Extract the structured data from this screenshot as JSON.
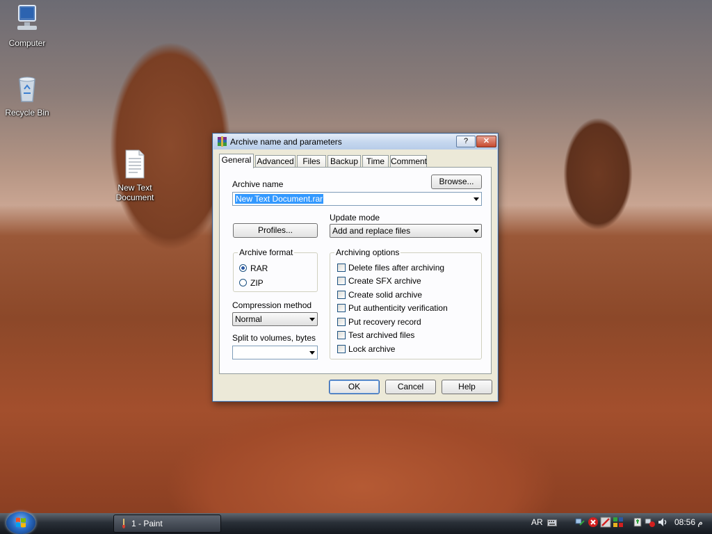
{
  "desktop": {
    "icons": [
      {
        "label": "Computer"
      },
      {
        "label": "Recycle Bin"
      },
      {
        "label_line1": "New Text",
        "label_line2": "Document"
      }
    ]
  },
  "dialog": {
    "title": "Archive name and parameters",
    "help_glyph": "?",
    "close_glyph": "✕",
    "tabs": [
      "General",
      "Advanced",
      "Files",
      "Backup",
      "Time",
      "Comment"
    ],
    "active_tab": "General",
    "archive_name_label": "Archive name",
    "browse_label": "Browse...",
    "archive_name_value": "New Text Document.rar",
    "profiles_label": "Profiles...",
    "update_mode_label": "Update mode",
    "update_mode_value": "Add and replace files",
    "archive_format": {
      "title": "Archive format",
      "options": [
        "RAR",
        "ZIP"
      ],
      "selected": "RAR"
    },
    "compression_label": "Compression method",
    "compression_value": "Normal",
    "split_label": "Split to volumes, bytes",
    "split_value": "",
    "archiving_options": {
      "title": "Archiving options",
      "items": [
        {
          "label": "Delete files after archiving",
          "checked": false
        },
        {
          "label": "Create SFX archive",
          "checked": false
        },
        {
          "label": "Create solid archive",
          "checked": false
        },
        {
          "label": "Put authenticity verification",
          "checked": false
        },
        {
          "label": "Put recovery record",
          "checked": false
        },
        {
          "label": "Test archived files",
          "checked": false
        },
        {
          "label": "Lock archive",
          "checked": false
        }
      ]
    },
    "ok_label": "OK",
    "cancel_label": "Cancel",
    "help_label": "Help"
  },
  "taskbar": {
    "task_label": "1 - Paint",
    "language": "AR",
    "clock": "08:56 م"
  },
  "colors": {
    "selection": "#3399ff",
    "accent_blue": "#2b58a3"
  }
}
